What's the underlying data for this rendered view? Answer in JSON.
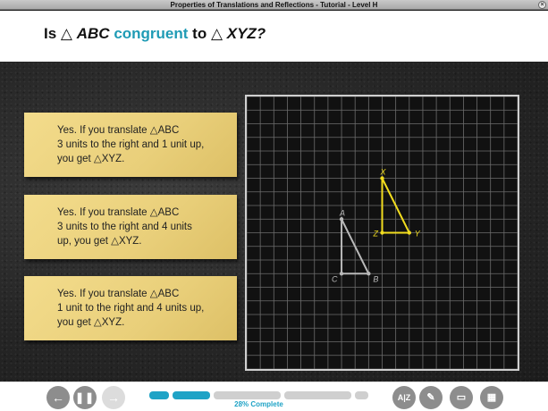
{
  "window": {
    "title": "Properties of Translations and Reflections - Tutorial - Level H"
  },
  "question": {
    "part1": "Is",
    "tri1": "△",
    "name1": "ABC",
    "keyword": "congruent",
    "part2": "to",
    "tri2": "△",
    "name2": "XYZ?"
  },
  "answers": [
    {
      "line1": "Yes. If you translate △ABC",
      "line2": "3 units to the right and 1 unit up,",
      "line3": "you get △XYZ."
    },
    {
      "line1": "Yes. If you translate △ABC",
      "line2": "3 units to the right and 4 units",
      "line3": "up, you get △XYZ."
    },
    {
      "line1": "Yes. If you translate △ABC",
      "line2": "1 unit to the right and 4 units up,",
      "line3": "you get △XYZ."
    }
  ],
  "grid": {
    "columns": 20,
    "rows": 20,
    "triangle_abc": {
      "color": "#b9b9b9",
      "points": [
        {
          "label": "A",
          "x": 7,
          "y": 9
        },
        {
          "label": "B",
          "x": 9,
          "y": 13
        },
        {
          "label": "C",
          "x": 7,
          "y": 13
        }
      ]
    },
    "triangle_xyz": {
      "color": "#f2dd1f",
      "points": [
        {
          "label": "X",
          "x": 10,
          "y": 6
        },
        {
          "label": "Y",
          "x": 12,
          "y": 10
        },
        {
          "label": "Z",
          "x": 10,
          "y": 10
        }
      ]
    }
  },
  "toolbar": {
    "back_icon": "back-arrow-icon",
    "pause_icon": "pause-icon",
    "forward_icon": "forward-arrow-icon",
    "back_glyph": "←",
    "pause_glyph": "❚❚",
    "forward_glyph": "→",
    "progress_percent": 28,
    "progress_label": "28% Complete",
    "glossary_glyph": "A|Z",
    "pencil_glyph": "✎",
    "notepad_glyph": "▭",
    "calculator_glyph": "▦",
    "accent": "#1fa3c6"
  }
}
